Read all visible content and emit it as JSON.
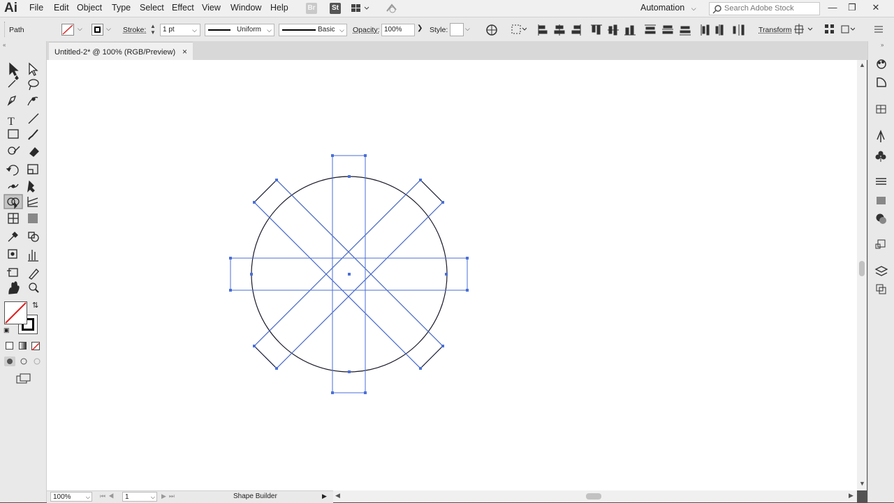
{
  "app": {
    "logo": "Ai",
    "menu": [
      "File",
      "Edit",
      "Object",
      "Type",
      "Select",
      "Effect",
      "View",
      "Window",
      "Help"
    ],
    "bridge_icon": "Br",
    "stock_icon": "St",
    "workspace": "Automation",
    "search_placeholder": "Search Adobe Stock"
  },
  "controlbar": {
    "selection_type": "Path",
    "stroke_label": "Stroke:",
    "stroke_weight": "1 pt",
    "profile": "Uniform",
    "brush": "Basic",
    "opacity_label": "Opacity:",
    "opacity_value": "100%",
    "style_label": "Style:",
    "transform_label": "Transform"
  },
  "document": {
    "tab_title": "Untitled-2* @ 100% (RGB/Preview)",
    "close_symbol": "×"
  },
  "status": {
    "zoom": "100%",
    "artboard_number": "1",
    "current_tool": "Shape Builder"
  },
  "colors": {
    "selection": "#4a6fd8",
    "path": "#1a1a2a",
    "chrome": "#e9e9e9"
  },
  "icons": [
    "selection-icon",
    "direct-selection-icon",
    "magic-wand-icon",
    "lasso-icon",
    "pen-icon",
    "curvature-icon",
    "type-icon",
    "line-icon",
    "rectangle-icon",
    "paintbrush-icon",
    "shaper-icon",
    "eraser-icon",
    "rotate-icon",
    "scale-icon",
    "width-icon",
    "puppet-warp-icon",
    "shape-builder-icon",
    "perspective-grid-icon",
    "mesh-icon",
    "gradient-icon",
    "eyedropper-icon",
    "blend-icon",
    "symbol-sprayer-icon",
    "column-graph-icon",
    "artboard-icon",
    "slice-icon",
    "hand-icon",
    "zoom-icon"
  ]
}
